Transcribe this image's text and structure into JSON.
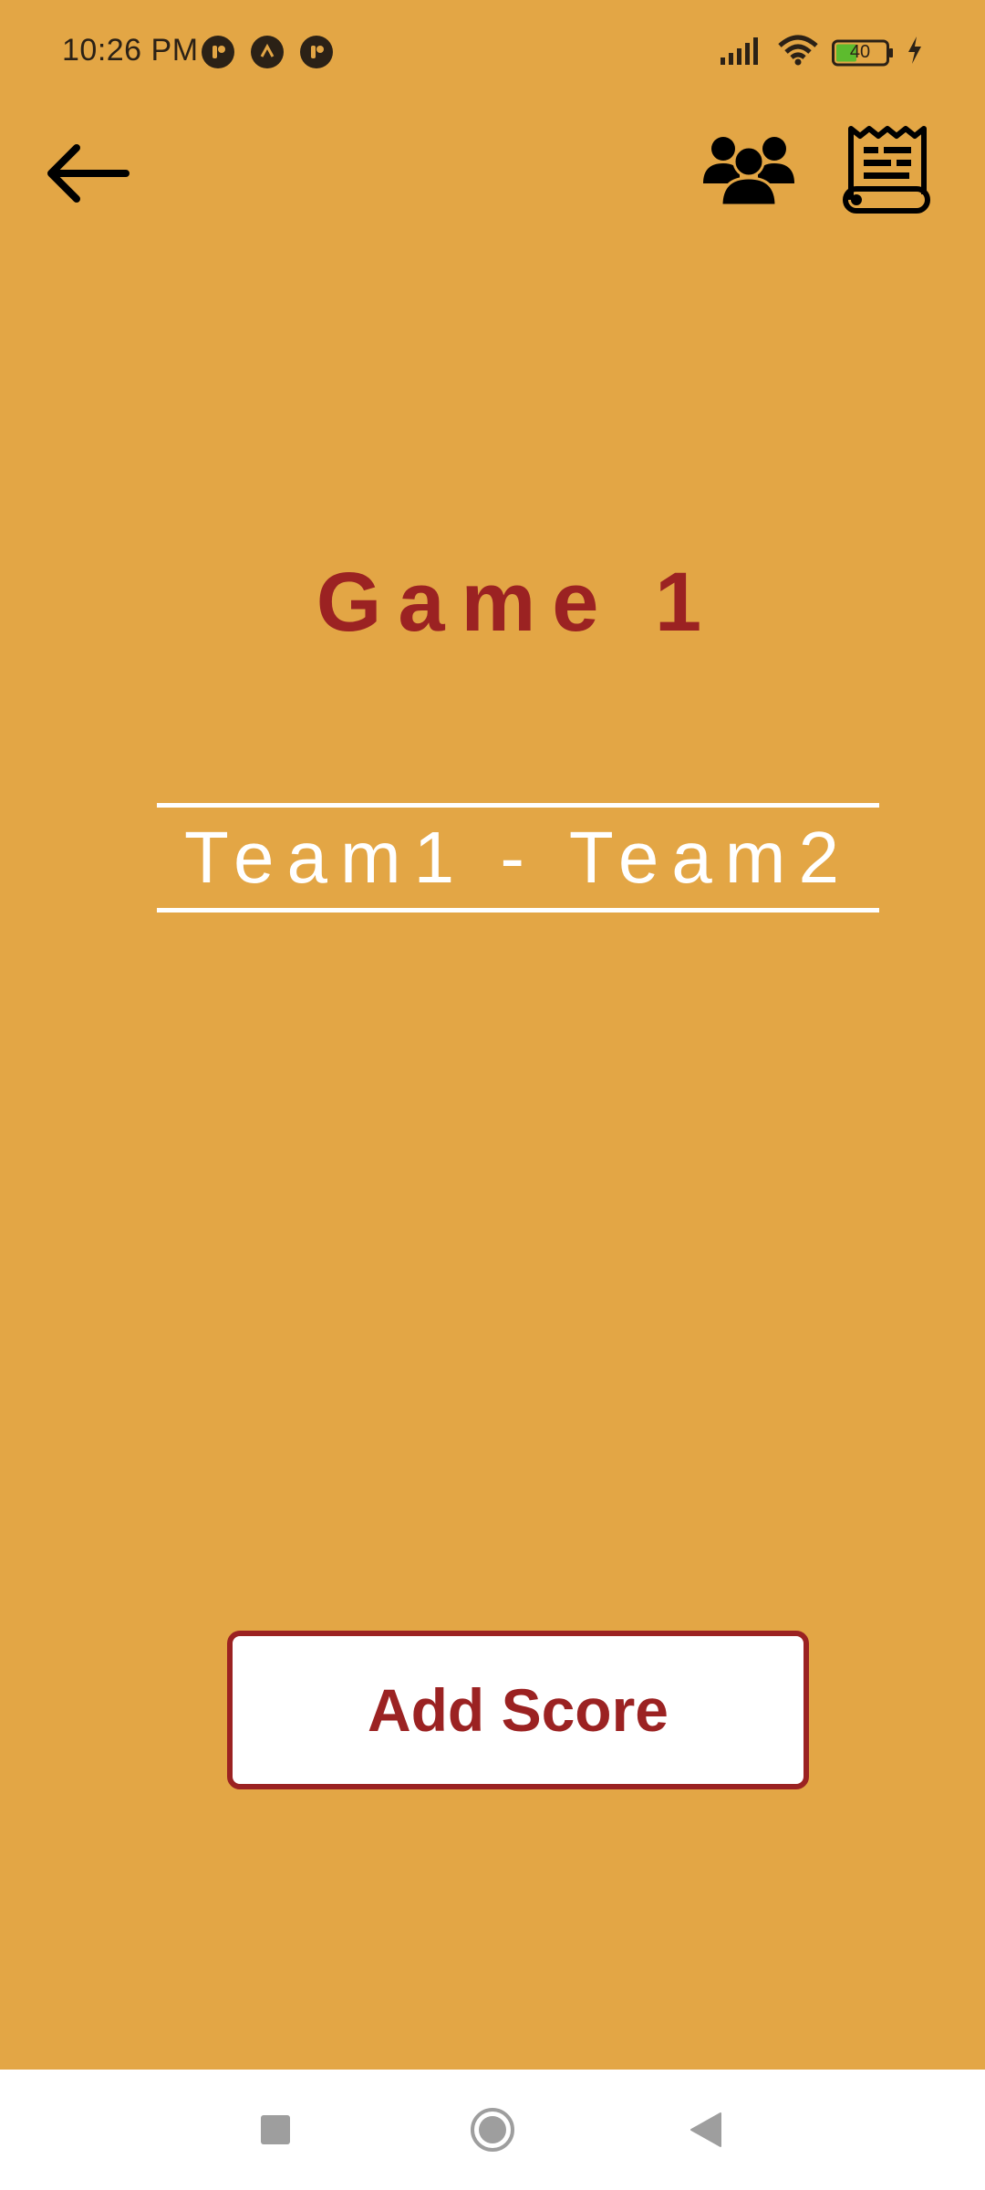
{
  "status_bar": {
    "time": "10:26 PM",
    "battery_level": "40",
    "left_icons": [
      "notification-icon",
      "arrow-up-icon",
      "notification-icon"
    ],
    "right_icons": [
      "signal-icon",
      "wifi-icon",
      "battery-icon",
      "charging-icon"
    ]
  },
  "top_bar": {
    "back_icon": "arrow-left-icon",
    "teams_icon": "users-group-icon",
    "scores_icon": "receipt-scroll-icon"
  },
  "main": {
    "title": "Game 1",
    "matchup": "Team1 - Team2",
    "add_score_label": "Add Score"
  },
  "colors": {
    "background": "#E3A645",
    "accent": "#9B2222",
    "white": "#FFFFFF"
  },
  "nav_bar": {
    "buttons": [
      "recents-square-icon",
      "home-circle-icon",
      "back-triangle-icon"
    ]
  }
}
